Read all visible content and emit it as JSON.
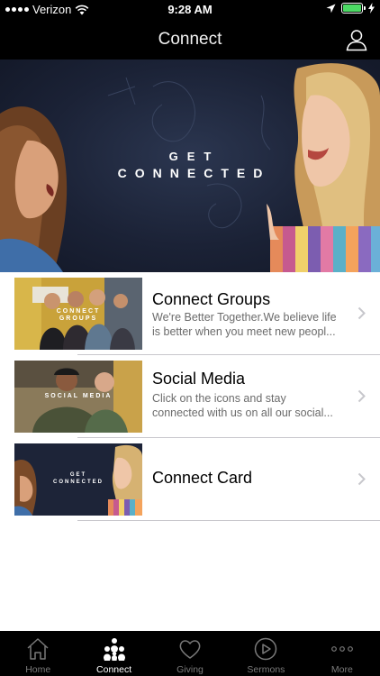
{
  "status_bar": {
    "carrier": "Verizon",
    "time": "9:28 AM"
  },
  "nav": {
    "title": "Connect"
  },
  "hero": {
    "line1": "GET",
    "line2": "CONNECTED"
  },
  "items": [
    {
      "title": "Connect Groups",
      "subtitle_line1": "We're Better Together.We believe life",
      "subtitle_line2": "is better when you meet new peopl...",
      "thumb_text_1": "CONNECT",
      "thumb_text_2": "GROUPS"
    },
    {
      "title": "Social Media",
      "subtitle_line1": "Click on the icons and stay",
      "subtitle_line2": "connected with us on all our social...",
      "thumb_text_1": "SOCIAL MEDIA"
    },
    {
      "title": "Connect Card",
      "thumb_text_1": "GET",
      "thumb_text_2": "CONNECTED"
    }
  ],
  "tabs": [
    {
      "label": "Home",
      "icon": "home-icon",
      "active": false
    },
    {
      "label": "Connect",
      "icon": "people-icon",
      "active": true
    },
    {
      "label": "Giving",
      "icon": "heart-icon",
      "active": false
    },
    {
      "label": "Sermons",
      "icon": "play-icon",
      "active": false
    },
    {
      "label": "More",
      "icon": "more-icon",
      "active": false
    }
  ],
  "colors": {
    "bar_background": "#000000",
    "battery": "#4cd964",
    "tab_active": "#ffffff",
    "tab_inactive": "#7a7a7a"
  }
}
